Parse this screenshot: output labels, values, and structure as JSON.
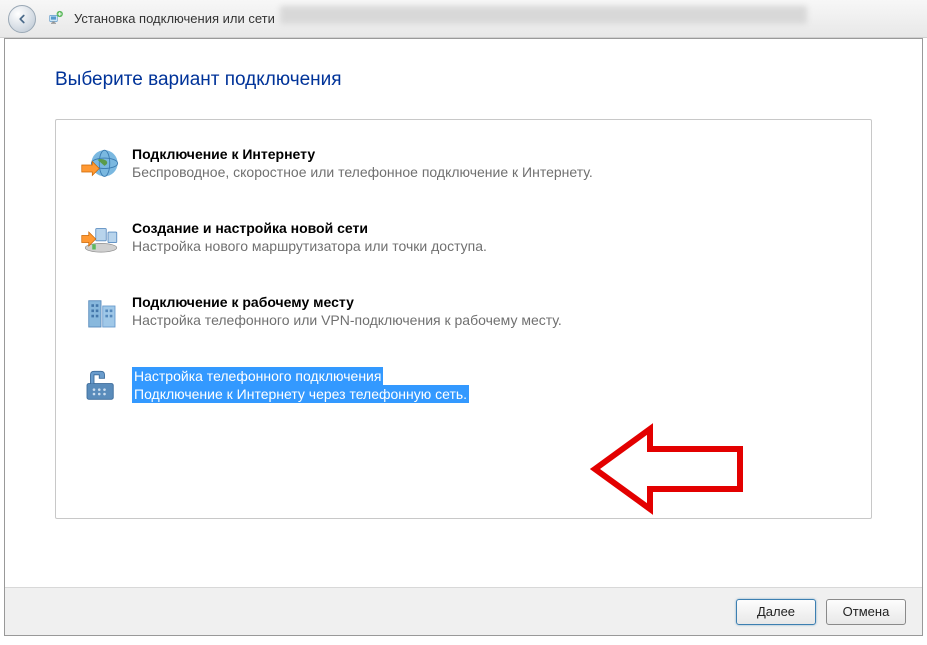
{
  "window": {
    "title": "Установка подключения или сети"
  },
  "wizard": {
    "heading": "Выберите вариант подключения"
  },
  "options": [
    {
      "title": "Подключение к Интернету",
      "desc": "Беспроводное, скоростное или телефонное подключение к Интернету.",
      "selected": false
    },
    {
      "title": "Создание и настройка новой сети",
      "desc": "Настройка нового маршрутизатора или точки доступа.",
      "selected": false
    },
    {
      "title": "Подключение к рабочему месту",
      "desc": "Настройка телефонного или VPN-подключения к рабочему месту.",
      "selected": false
    },
    {
      "title": "Настройка телефонного подключения",
      "desc": "Подключение к Интернету через телефонную сеть.",
      "selected": true
    }
  ],
  "buttons": {
    "next": "Далее",
    "cancel": "Отмена"
  }
}
